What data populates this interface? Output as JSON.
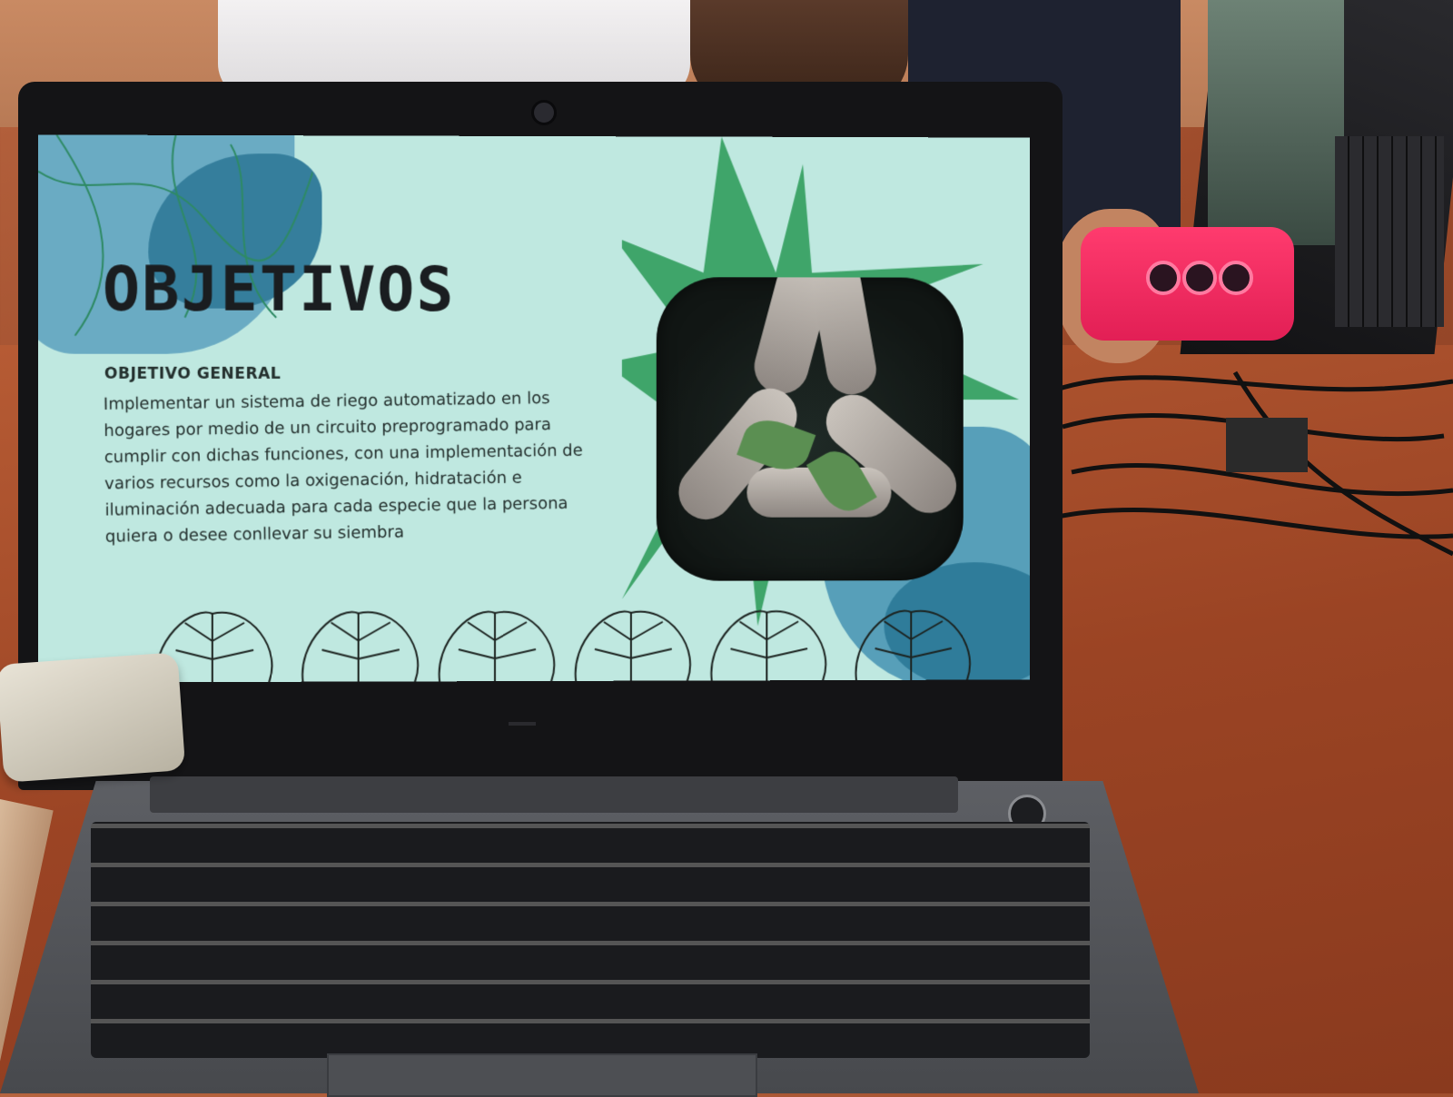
{
  "slide": {
    "title": "OBJETIVOS",
    "subheading": "OBJETIVO GENERAL",
    "body": "Implementar un sistema de riego automatizado en los hogares por medio de un circuito preprogramado para cumplir con dichas funciones, con una implementación de varios recursos como la oxigenación, hidratación e iluminación adecuada para cada especie que la persona quiera o desee conllevar su siembra"
  },
  "colors": {
    "slide_background": "#bfe8e0",
    "accent_green": "#3fa56a",
    "accent_blue": "#357e9c",
    "title_text": "#1a1d20"
  }
}
